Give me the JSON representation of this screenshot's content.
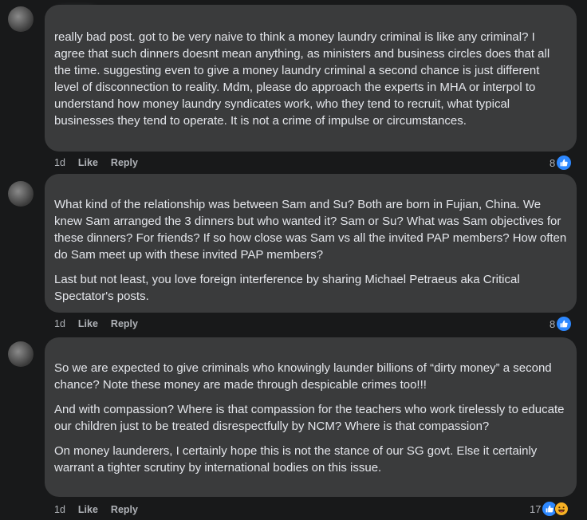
{
  "comments": [
    {
      "paragraphs": [
        "really bad post. got to be very naive to think a money laundry criminal is like any criminal? I agree that such dinners doesnt mean anything, as ministers and business circles does that all the time. suggesting even to give a money laundry criminal a second chance is just different level of disconnection to reality. Mdm, please do approach the experts in MHA or interpol to understand how money laundry syndicates work, who they tend to recruit, what typical businesses they tend to operate. It is not a crime of impulse or circumstances."
      ],
      "time": "1d",
      "like_label": "Like",
      "reply_label": "Reply",
      "reaction_count": "8",
      "reactions": [
        "like-icon"
      ]
    },
    {
      "paragraphs": [
        "What kind of the relationship was between Sam and Su? Both are born in Fujian, China. We knew Sam arranged the 3 dinners but who wanted it? Sam or Su? What was Sam objectives for these dinners? For friends? If so how close was Sam vs all the invited PAP members? How often do Sam meet up with these invited PAP members?",
        "Last but not least, you love foreign interference by sharing Michael Petraeus aka Critical Spectator's posts."
      ],
      "time": "1d",
      "like_label": "Like",
      "reply_label": "Reply",
      "reaction_count": "8",
      "reactions": [
        "like-icon"
      ]
    },
    {
      "paragraphs": [
        "So we are expected to give criminals who knowingly launder billions of “dirty money” a second chance? Note these money are made through despicable crimes too!!!",
        "And with compassion? Where is that compassion for the teachers who work tirelessly to educate our children just to be treated disrespectfully by NCM? Where is that compassion?",
        "On money launderers, I certainly hope this is not the stance of our SG govt. Else it certainly warrant a tighter scrutiny by international bodies on this issue."
      ],
      "time": "1d",
      "like_label": "Like",
      "reply_label": "Reply",
      "reaction_count": "17",
      "reactions": [
        "like-icon",
        "haha-icon"
      ]
    }
  ],
  "colors": {
    "background": "#18191a",
    "bubble": "#3a3b3c",
    "text": "#e4e6eb",
    "secondary_text": "#b0b3b8",
    "like_blue": "#2d88ff",
    "haha_yellow": "#f7b125"
  }
}
